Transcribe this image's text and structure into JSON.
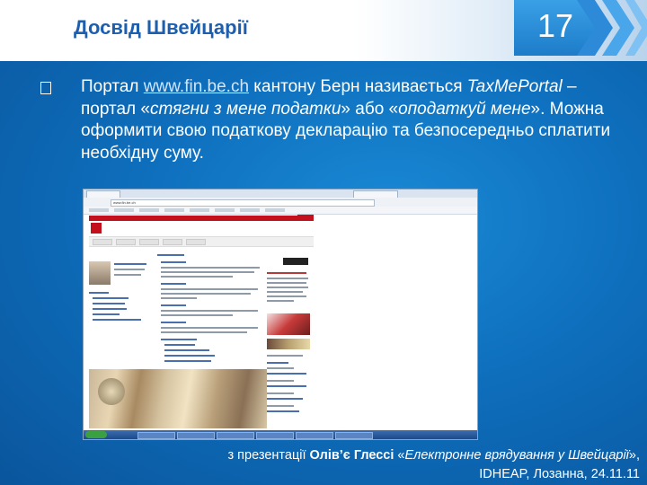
{
  "header": {
    "title": "Досвід Швейцарії",
    "slide_number": "17"
  },
  "body": {
    "bullet_icon": "square-bullet-icon",
    "intro": "Портал ",
    "link": "www.fin.be.ch",
    "part2": " кантону Берн називається ",
    "portal_name": "TaxMePortal",
    "part3": " – портал «",
    "quote1": "стягни з мене податки",
    "part4": "» або «",
    "quote2": "оподаткуй мене",
    "part5": "». Можна оформити свою податкову декларацію та безпосередньо сплатити необхідну суму."
  },
  "screenshot": {
    "address": "www.fin.be.ch"
  },
  "caption": {
    "prefix": "з презентації ",
    "author": "Олів’є Глессі",
    "mid": " «",
    "work": "Електронне врядування у Швейцарії",
    "end": "»,",
    "line2": "IDHEAP, Лозанна, 24.11.11"
  },
  "colors": {
    "background": "#0e6fbd",
    "title": "#1d5fae",
    "slide_number_box": "#1d7cc9",
    "text": "#ffffff"
  }
}
